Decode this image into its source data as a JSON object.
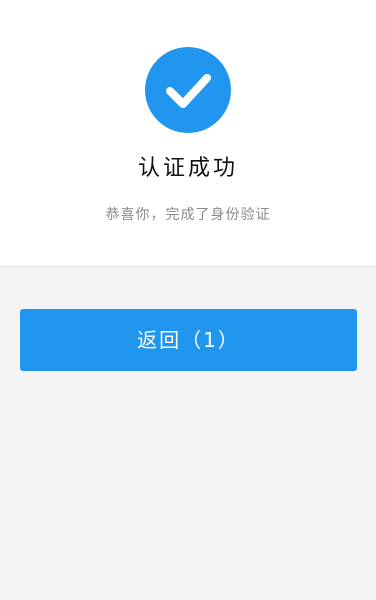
{
  "result": {
    "icon": "check-icon",
    "title": "认证成功",
    "subtitle": "恭喜你，完成了身份验证"
  },
  "actions": {
    "return_label": "返回（1）"
  },
  "colors": {
    "accent": "#2196ee",
    "background": "#f4f4f4",
    "panel": "#ffffff",
    "title_text": "#111111",
    "subtitle_text": "#8a8a8a"
  }
}
